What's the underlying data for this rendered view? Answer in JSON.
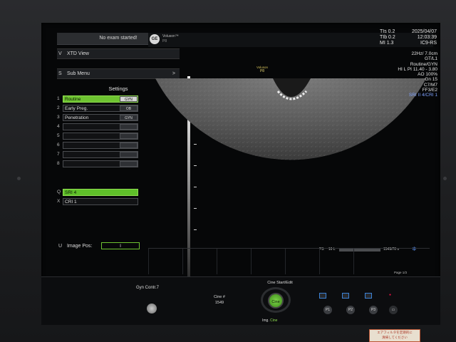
{
  "left_panel": {
    "exam_banner": "No exam started!",
    "xtd": {
      "hotkey": "V",
      "label": "XTD View"
    },
    "submenu": {
      "hotkey": "S",
      "label": "Sub Menu",
      "chevron": ">"
    },
    "settings_title": "Settings",
    "presets": [
      {
        "num": "1",
        "label": "Routine",
        "tag": "GYN",
        "active": true
      },
      {
        "num": "2",
        "label": "Early Preg.",
        "tag": "OB",
        "active": false
      },
      {
        "num": "3",
        "label": "Penetration",
        "tag": "GYN",
        "active": false
      },
      {
        "num": "4",
        "label": "",
        "tag": "",
        "active": false
      },
      {
        "num": "5",
        "label": "",
        "tag": "",
        "active": false
      },
      {
        "num": "6",
        "label": "",
        "tag": "",
        "active": false
      },
      {
        "num": "7",
        "label": "",
        "tag": "",
        "active": false
      },
      {
        "num": "8",
        "label": "",
        "tag": "",
        "active": false
      }
    ],
    "q_select": {
      "hotkey": "Q",
      "label": "SRI 4"
    },
    "x_select": {
      "hotkey": "X",
      "label": "CRI 1"
    },
    "image_pos": {
      "hotkey": "U",
      "label": "Image Pos:",
      "value": "I"
    }
  },
  "header": {
    "logo_text": "GE",
    "brand": "Voluson™",
    "probe_line": "P8",
    "tis": "TIs  0.2",
    "tib": "TIb  0.2",
    "mi": "MI  1.3",
    "date": "2025/04/07",
    "time": "12:03:39",
    "probe": "IC9-RS"
  },
  "info_block": {
    "lines": [
      "22Hz/ 7.0cm",
      "GT/L1",
      "Routine/GYN",
      "HI L PI 11.40 - 3.80",
      "AO 100%",
      "Gn 15",
      "C7/M7",
      "FF3/E2"
    ],
    "highlight": "SRI II 4/CRI 1"
  },
  "vol_tag": {
    "brand": "Voluson",
    "p": "P8"
  },
  "cine_bar": {
    "left": "P3:",
    "count": "10 L",
    "right": "1549/70 s"
  },
  "page_indicator": "Page 1/3",
  "bottom": {
    "gyn_contr": "Gyn Contr.7",
    "cine_no_label": "Cine #",
    "cine_no_value": "1549",
    "cine_title": "Cine Start/Edit",
    "cine_button": "Cine",
    "img_label": "Img.",
    "img_value": "Cine",
    "p1": "P1",
    "p2": "P2",
    "p3": "P3"
  },
  "sticker": {
    "line1": "エアフィルタを定期的に",
    "line2": "清掃してください"
  },
  "colors": {
    "accent_green": "#6ec331",
    "info_blue": "#7fa2ff",
    "panel_bg": "#060708"
  }
}
